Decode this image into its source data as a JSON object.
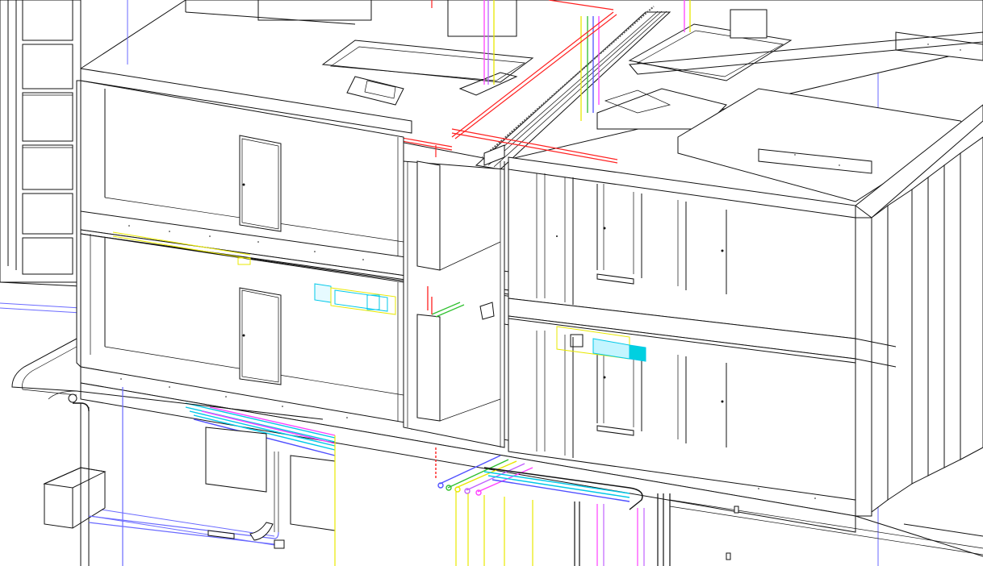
{
  "view": {
    "background": "#ffffff"
  },
  "colors": {
    "line": "#111111",
    "sprinkler": "#ff2020",
    "supply_air": "#00c8e8",
    "return_air": "#e8e800",
    "plumbing_green": "#30c030",
    "plumbing_magenta": "#ff40ff",
    "plumbing_blue": "#5050ff",
    "drainage_purple": "#c060ff",
    "grid_blue": "#6a6aff"
  },
  "elements": {
    "icons": [
      "door-icon",
      "duct-icon",
      "pipe-icon",
      "stair-icon"
    ]
  }
}
